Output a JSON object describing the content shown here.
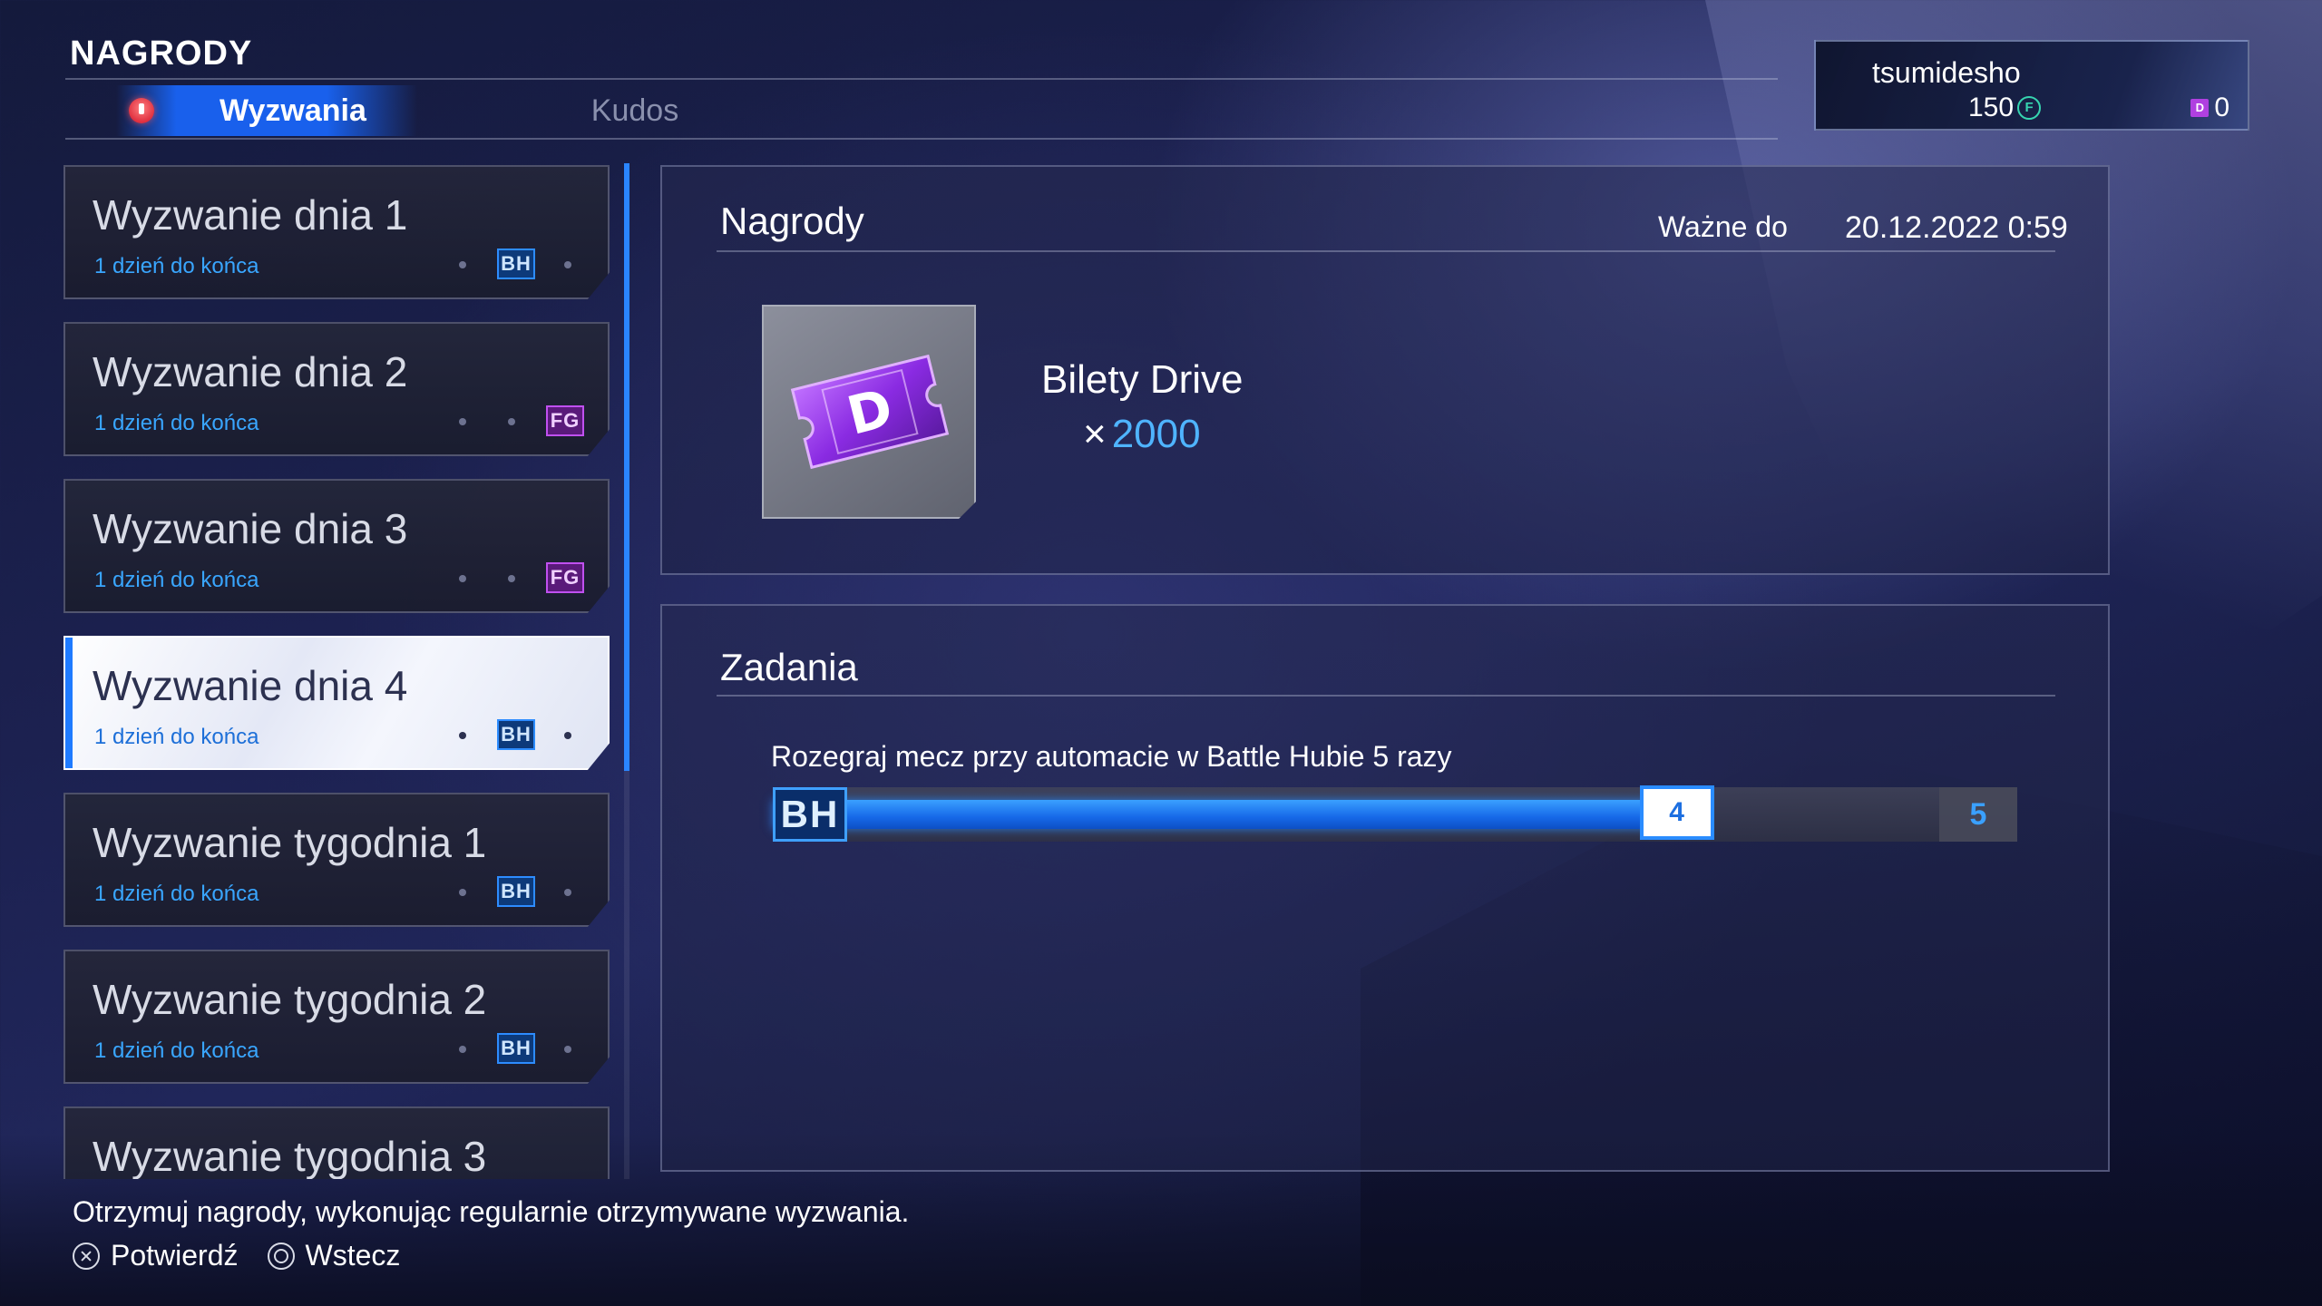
{
  "header": {
    "title": "NAGRODY",
    "tabs": [
      {
        "label": "Wyzwania",
        "active": true
      },
      {
        "label": "Kudos",
        "active": false
      }
    ]
  },
  "account": {
    "username": "tsumidesho",
    "coins": "150",
    "coin_icon": "F",
    "tickets": "0",
    "ticket_icon": "D"
  },
  "challenges": [
    {
      "title": "Wyzwanie dnia 1",
      "subtitle": "1 dzień do końca",
      "badge": "BH",
      "selected": false
    },
    {
      "title": "Wyzwanie dnia 2",
      "subtitle": "1 dzień do końca",
      "badge": "FG",
      "selected": false
    },
    {
      "title": "Wyzwanie dnia 3",
      "subtitle": "1 dzień do końca",
      "badge": "FG",
      "selected": false
    },
    {
      "title": "Wyzwanie dnia 4",
      "subtitle": "1 dzień do końca",
      "badge": "BH",
      "selected": true
    },
    {
      "title": "Wyzwanie tygodnia 1",
      "subtitle": "1 dzień do końca",
      "badge": "BH",
      "selected": false
    },
    {
      "title": "Wyzwanie tygodnia 2",
      "subtitle": "1 dzień do końca",
      "badge": "BH",
      "selected": false
    },
    {
      "title": "Wyzwanie tygodnia 3",
      "subtitle": "",
      "badge": "",
      "selected": false
    }
  ],
  "rewards": {
    "title": "Nagrody",
    "valid_label": "Ważne do",
    "valid_value": "20.12.2022 0:59",
    "item_name": "Bilety Drive",
    "quantity_prefix": "×",
    "quantity": "2000",
    "item_icon_letter": "D"
  },
  "tasks": {
    "title": "Zadania",
    "description": "Rozegraj mecz przy automacie w Battle Hubie 5 razy",
    "badge": "BH",
    "progress_current": 4,
    "progress_goal": 5,
    "current_label": "4",
    "goal_label": "5"
  },
  "footer": {
    "hint": "Otrzymuj nagrody, wykonując regularnie otrzymywane wyzwania.",
    "confirm_label": "Potwierdź",
    "back_label": "Wstecz"
  },
  "colors": {
    "accent": "#2a8cff",
    "bh_badge": "#0d3a7a",
    "fg_badge": "#5a1a7a",
    "coin": "#36d4b0"
  }
}
